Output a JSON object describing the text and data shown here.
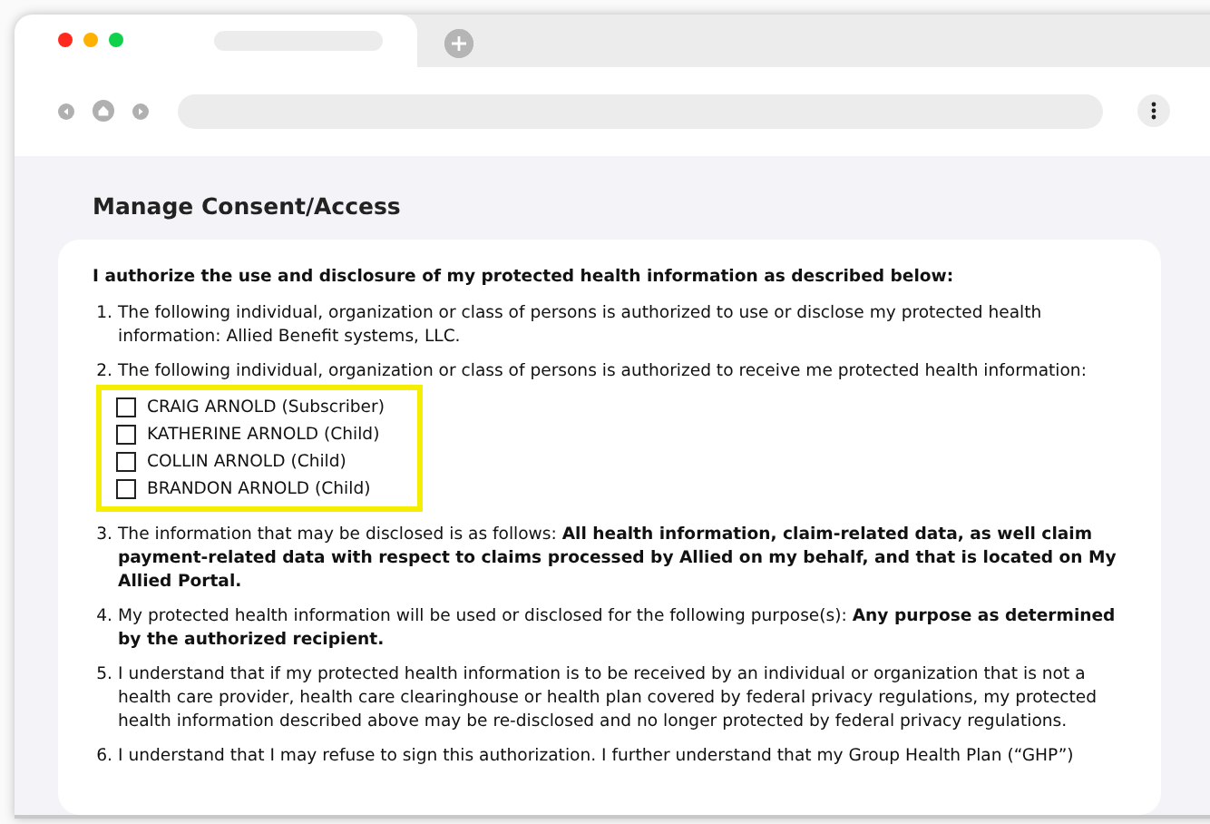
{
  "page": {
    "title": "Manage Consent/Access"
  },
  "consent": {
    "heading": "I authorize the use and disclosure of my protected health information as described below:",
    "items": [
      {
        "number": "1.",
        "text": "The following individual, organization or class of persons is authorized to use or disclose my protected health information: Allied Benefit systems, LLC."
      },
      {
        "number": "2.",
        "text": "The following individual, organization or class of persons is authorized to receive me protected health information:",
        "highlighted": true,
        "options": [
          {
            "label": "CRAIG ARNOLD (Subscriber)",
            "checked": false
          },
          {
            "label": "KATHERINE ARNOLD (Child)",
            "checked": false
          },
          {
            "label": "COLLIN ARNOLD (Child)",
            "checked": false
          },
          {
            "label": "BRANDON ARNOLD (Child)",
            "checked": false
          }
        ]
      },
      {
        "number": "3.",
        "text": "The information that may be disclosed is as follows: **All health information, claim-related data, as well claim payment-related data with respect to claims processed by Allied on my behalf, and that is located on My Allied Portal.**"
      },
      {
        "number": "4.",
        "text": "My protected health information will be used or disclosed for the following purpose(s): **Any purpose as determined by the authorized recipient.**"
      },
      {
        "number": "5.",
        "text": "I understand that if my protected health information is to be received by an individual or organization that is not a health care provider, health care clearinghouse or health plan covered by federal privacy regulations, my protected health information described above may be re-disclosed and no longer protected by federal privacy regulations."
      },
      {
        "number": "6.",
        "text": "I understand that I may refuse to sign this authorization. I further understand that my Group Health Plan (“GHP”)"
      }
    ]
  }
}
